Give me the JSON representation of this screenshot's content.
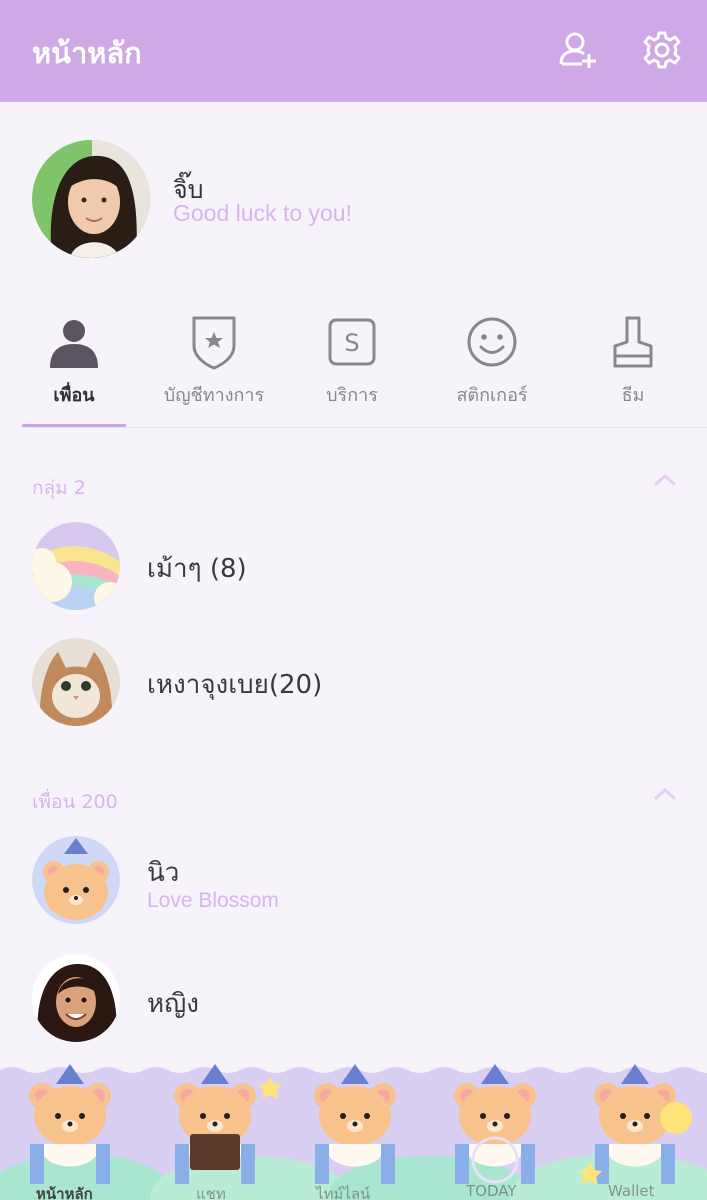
{
  "header": {
    "title": "หน้าหลัก",
    "icons": [
      "add-friend-icon",
      "settings-icon"
    ]
  },
  "profile": {
    "name": "จิ๊บ",
    "status": "Good luck to you!"
  },
  "tabs": [
    {
      "label": "เพื่อน",
      "icon": "person-icon",
      "active": true
    },
    {
      "label": "บัญชีทางการ",
      "icon": "official-account-icon"
    },
    {
      "label": "บริการ",
      "icon": "services-icon"
    },
    {
      "label": "สติกเกอร์",
      "icon": "smiley-icon"
    },
    {
      "label": "ธีม",
      "icon": "brush-icon"
    }
  ],
  "groups": {
    "header": "กลุ่ม 2",
    "items": [
      {
        "name": "เม้าๆ (8)"
      },
      {
        "name": "เหงาจุงเบย(20)"
      }
    ]
  },
  "friends": {
    "header": "เพื่อน 200",
    "items": [
      {
        "name": "นิว",
        "status": "Love Blossom"
      },
      {
        "name": "หญิง"
      }
    ]
  },
  "bottom_nav": [
    {
      "label": "หน้าหลัก",
      "active": true
    },
    {
      "label": "แชท"
    },
    {
      "label": "ไทม์ไลน์"
    },
    {
      "label": "TODAY"
    },
    {
      "label": "Wallet"
    }
  ],
  "colors": {
    "header": "#cfa8e6",
    "accent": "#d7b4ec",
    "background": "#f7f3fb"
  }
}
